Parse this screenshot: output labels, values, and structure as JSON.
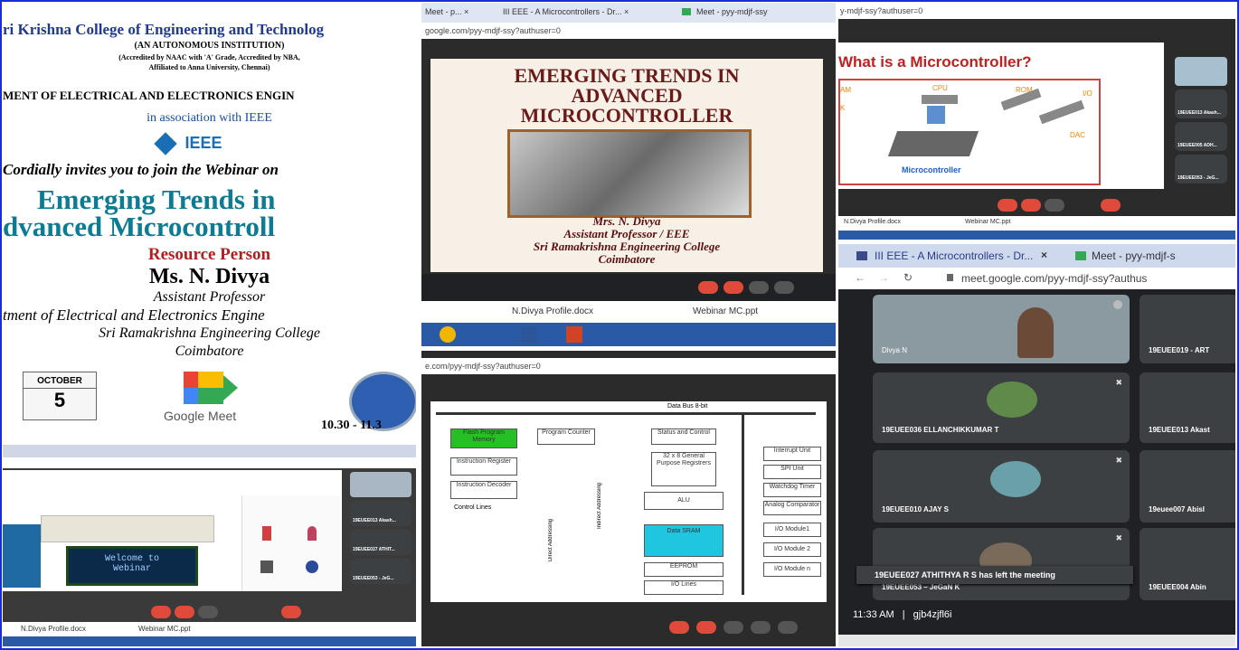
{
  "invite": {
    "college": "ri Krishna College of Engineering and Technolog",
    "autonomous": "(AN AUTONOMOUS INSTITUTION)",
    "accredited": "(Accredited by NAAC with 'A' Grade, Accredited by NBA,",
    "affiliated": "Affiliated to Anna University, Chennai)",
    "department": "MENT OF ELECTRICAL AND ELECTRONICS ENGIN",
    "association": "in association with IEEE",
    "ieee_logo": "IEEE",
    "invites": "Cordially invites you to join the Webinar on",
    "title1": "Emerging Trends in",
    "title2": "dvanced Microcontroll",
    "rp_label": "Resource Person",
    "rp_name": "Ms. N. Divya",
    "rp_role": "Assistant Professor",
    "rp_dept": "tment of Electrical and Electronics Engine",
    "rp_college": "Sri Ramakrishna Engineering College",
    "rp_city": "Coimbatore",
    "month": "OCTOBER",
    "day": "5",
    "meet": "Google Meet",
    "time": "10.30 - 11.3"
  },
  "slide_panel": {
    "tab1": "Meet - p... ×",
    "tab2": "III EEE - A Microcontrollers - Dr... ×",
    "tab3": "Meet - pyy-mdjf-ssy",
    "url": "google.com/pyy-mdjf-ssy?authuser=0",
    "title1": "EMERGING TRENDS IN",
    "title2": "ADVANCED",
    "title3": "MICROCONTROLLER",
    "name": "Mrs. N. Divya",
    "role": "Assistant Professor / EEE",
    "college": "Sri Ramakrishna Engineering College",
    "city": "Coimbatore",
    "file1": "N.Divya Profile.docx",
    "file2": "Webinar MC.ppt"
  },
  "micro_panel": {
    "url": "y-mdjf-ssy?authuser=0",
    "question": "What is a Microcontroller?",
    "labels": {
      "cpu": "CPU",
      "rom": "ROM",
      "io": "I/O",
      "dac": "DAC",
      "am": "AM",
      "k": "K",
      "mc": "Microcontroller"
    },
    "participants": [
      "19EUEE013 Akash...",
      "19EUEE005 ADH...",
      "19EUEE053 - JeG..."
    ],
    "file1": "N.Divya Profile.docx",
    "file2": "Webinar MC.ppt"
  },
  "tinkercad": {
    "lcd1": "Welcome to",
    "lcd2": "Webinar",
    "participants": [
      "19EUEE013 Akash...",
      "19EUEE027 ATHIT...",
      "19EUEE053 - JeG..."
    ],
    "file1": "N.Divya Profile.docx",
    "file2": "Webinar MC.ppt"
  },
  "block_panel": {
    "url": "e.com/pyy-mdjf-ssy?authuser=0",
    "bus": "Data Bus 8-bit",
    "flash": "Flash Program Memory",
    "pc": "Program Counter",
    "status": "Status and Control",
    "ir": "Instruction Register",
    "regs": "32 x 8 General Purpose Registrers",
    "idec": "Instruction Decoder",
    "alu": "ALU",
    "ctrl": "Control Lines",
    "sram": "Data SRAM",
    "eeprom": "EEPROM",
    "iolines": "I/O Lines",
    "interrupt": "Interrupt Unit",
    "spi": "SPI Unit",
    "wdt": "Watchdog Timer",
    "acomp": "Analog Comparator",
    "io1": "I/O Module1",
    "io2": "I/O Module 2",
    "io3": "I/O Module n",
    "direct": "Direct Addressing",
    "indirect": "Indirect Addressing"
  },
  "meet_panel": {
    "tab1": "III EEE - A Microcontrollers - Dr...",
    "tab1_close": "×",
    "tab2": "Meet - pyy-mdjf-s",
    "url": "meet.google.com/pyy-mdjf-ssy?authus",
    "tiles": [
      "Divya N",
      "19EUEE019 - ART",
      "19EUEE036 ELLANCHIKKUMAR T",
      "19EUEE013 Akast",
      "19EUEE010 AJAY S",
      "19euee007 Abisl",
      "19EUEE053 – JeGaN K",
      "19EUEE004 Abin"
    ],
    "toast": "19EUEE027 ATHITHYA R S has left the meeting",
    "clock": "11:33 AM",
    "sep": "|",
    "code": "gjb4zjfl6i"
  }
}
